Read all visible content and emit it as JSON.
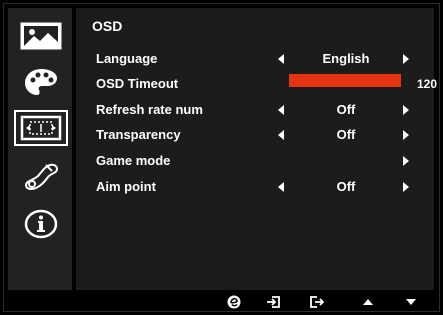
{
  "menu": {
    "title": "OSD",
    "items": [
      {
        "label": "Language",
        "value": "English",
        "has_left_arrow": true,
        "has_right_arrow": true
      },
      {
        "label": "OSD Timeout",
        "bar_value": "120",
        "bar_fraction": 1.0
      },
      {
        "label": "Refresh rate num",
        "value": "Off",
        "has_left_arrow": true,
        "has_right_arrow": true
      },
      {
        "label": "Transparency",
        "value": "Off",
        "has_left_arrow": true,
        "has_right_arrow": true
      },
      {
        "label": "Game mode",
        "value": "",
        "has_left_arrow": false,
        "has_right_arrow": true
      },
      {
        "label": "Aim point",
        "value": "Off",
        "has_left_arrow": true,
        "has_right_arrow": true
      }
    ]
  },
  "sidebar": {
    "items": [
      {
        "icon": "picture-icon"
      },
      {
        "icon": "color-palette-icon"
      },
      {
        "icon": "display-setting-icon",
        "active": true
      },
      {
        "icon": "wrench-settings-icon"
      },
      {
        "icon": "info-icon"
      }
    ]
  },
  "bottom_bar": {
    "icons": [
      "acer-e-icon",
      "enter-icon",
      "exit-icon",
      "up-arrow-icon",
      "down-arrow-icon"
    ]
  },
  "colors": {
    "accent": "#e63312",
    "panel": "#1c1c1c",
    "sidebar": "#222222",
    "background": "#000000"
  }
}
